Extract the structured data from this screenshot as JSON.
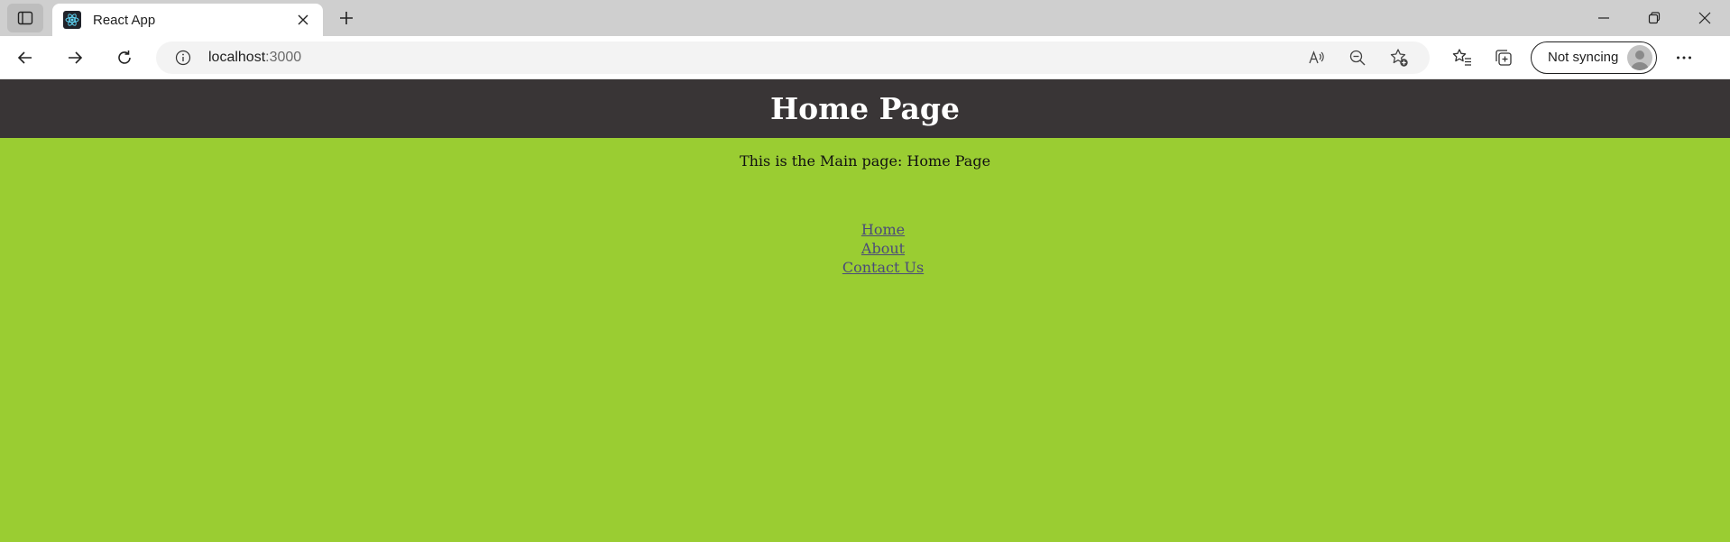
{
  "browser": {
    "tab": {
      "title": "React App",
      "favicon": "react-icon"
    },
    "address": {
      "host": "localhost",
      "port": ":3000"
    },
    "profile": {
      "label": "Not syncing"
    },
    "icons": {
      "tab_actions": "tab-actions-icon",
      "close_tab": "close-icon",
      "new_tab": "plus-icon",
      "minimize": "minimize-icon",
      "restore": "restore-icon",
      "close_window": "close-icon",
      "back": "back-arrow-icon",
      "forward": "forward-arrow-icon",
      "refresh": "refresh-icon",
      "site_info": "info-icon",
      "read_aloud": "read-aloud-icon",
      "zoom": "zoom-out-icon",
      "add_favorite": "star-add-icon",
      "favorites": "favorites-icon",
      "collections": "collections-icon",
      "more": "more-icon"
    }
  },
  "page": {
    "header_title": "Home Page",
    "main_text": "This is the Main page: Home Page",
    "links": [
      {
        "label": "Home"
      },
      {
        "label": "About"
      },
      {
        "label": "Contact Us"
      }
    ],
    "colors": {
      "header_bg": "#393536",
      "body_bg": "#9acd32",
      "link": "#4a4a7a"
    }
  }
}
